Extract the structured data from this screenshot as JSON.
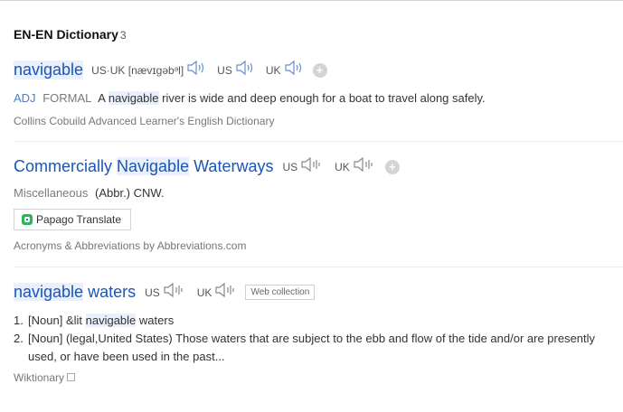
{
  "section": {
    "title": "EN-EN Dictionary",
    "count": "3"
  },
  "entries": [
    {
      "word": "navigable",
      "pronunciation": "US·UK [nævɪɡəbᵊl]",
      "us_label": "US",
      "uk_label": "UK",
      "definition": {
        "pos": "ADJ",
        "register": "FORMAL",
        "text_before": "A",
        "highlight": "navigable",
        "text_after": "river is wide and deep enough for a boat to travel along safely."
      },
      "source": "Collins Cobuild Advanced Learner's English Dictionary"
    },
    {
      "word_part1": "Commercially",
      "word_part2": "Navigable",
      "word_part3": "Waterways",
      "us_label": "US",
      "uk_label": "UK",
      "category": "Miscellaneous",
      "definition": "(Abbr.) CNW.",
      "translate_button": "Papago Translate",
      "source": "Acronyms & Abbreviations by Abbreviations.com"
    },
    {
      "word_part1": "navigable",
      "word_part2": "waters",
      "us_label": "US",
      "uk_label": "UK",
      "tag": "Web collection",
      "definitions": [
        {
          "num": "1.",
          "pos": "[Noun]",
          "before": "&lit",
          "highlight": "navigable",
          "after": "waters"
        },
        {
          "num": "2.",
          "pos": "[Noun]",
          "before": "(legal,United States) Those waters that are subject to the ebb and flow of the tide and/or are presently used, or have been used in the past..."
        }
      ],
      "source": "Wiktionary"
    }
  ],
  "colors": {
    "link": "#1a55b7",
    "highlight": "#e7f0fc",
    "muted": "#777777"
  },
  "icons": [
    "speaker-icon",
    "add-icon",
    "papago-logo-icon",
    "copy-icon"
  ]
}
